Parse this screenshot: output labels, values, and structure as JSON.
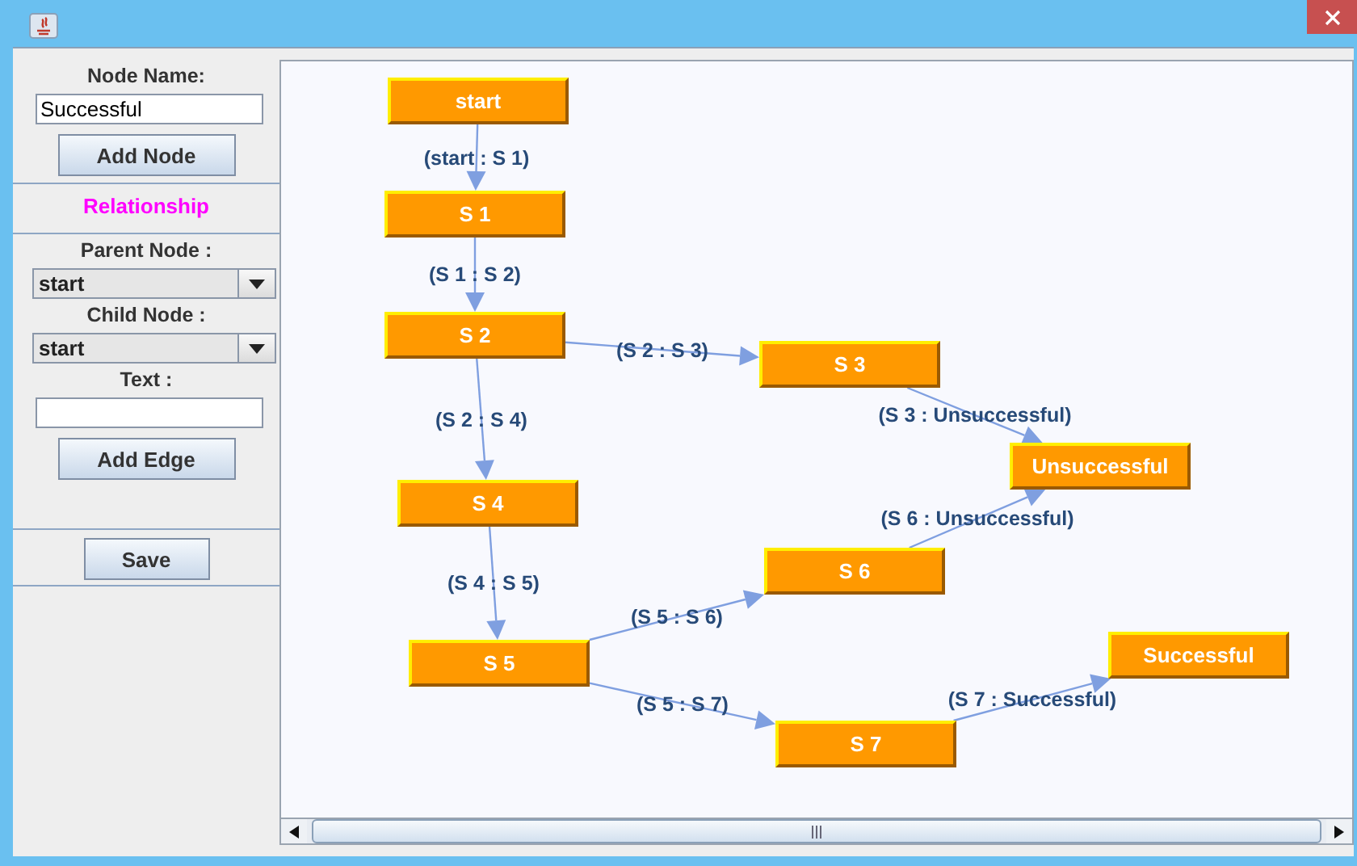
{
  "form": {
    "node_name_label": "Node Name:",
    "node_name_value": "Successful",
    "add_node": "Add Node",
    "relationship_heading": "Relationship",
    "parent_label": "Parent Node :",
    "parent_value": "start",
    "child_label": "Child Node :",
    "child_value": "start",
    "text_label": "Text :",
    "add_edge": "Add Edge",
    "save": "Save"
  },
  "graph": {
    "nodes": [
      {
        "label": "start"
      },
      {
        "label": "S 1"
      },
      {
        "label": "S 2"
      },
      {
        "label": "S 3"
      },
      {
        "label": "Unsuccessful"
      },
      {
        "label": "S 4"
      },
      {
        "label": "S 6"
      },
      {
        "label": "S 5"
      },
      {
        "label": "Successful"
      },
      {
        "label": "S 7"
      }
    ],
    "edges": [
      {
        "label": "(start : S 1)"
      },
      {
        "label": "(S 1 : S 2)"
      },
      {
        "label": "(S 2 : S 3)"
      },
      {
        "label": "(S 2 : S 4)"
      },
      {
        "label": "(S 3 : Unsuccessful)"
      },
      {
        "label": "(S 4 : S 5)"
      },
      {
        "label": "(S 5 : S 6)"
      },
      {
        "label": "(S 6 : Unsuccessful)"
      },
      {
        "label": "(S 5 : S 7)"
      },
      {
        "label": "(S 7 : Successful)"
      }
    ]
  }
}
